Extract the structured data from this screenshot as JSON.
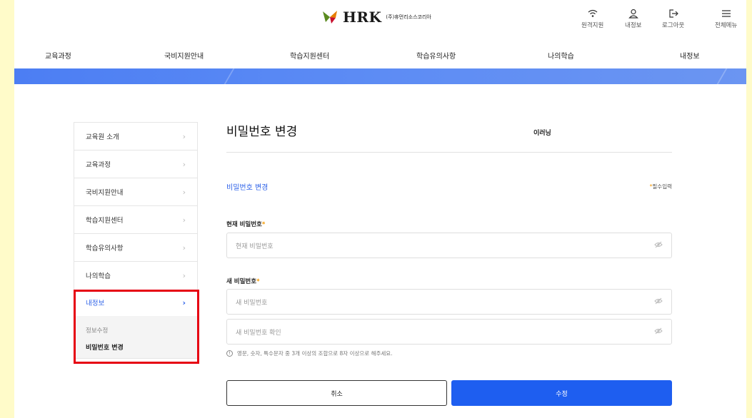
{
  "header": {
    "logo_text": "HRK",
    "logo_sub_main": "이러닝",
    "logo_sub_small": "(주)휴먼리소스코리아",
    "utils": [
      {
        "label": "원격지원",
        "icon": "wifi-icon"
      },
      {
        "label": "내정보",
        "icon": "user-icon"
      },
      {
        "label": "로그아웃",
        "icon": "logout-icon"
      },
      {
        "label": "전체메뉴",
        "icon": "menu-icon"
      }
    ]
  },
  "nav": [
    "교육과정",
    "국비지원안내",
    "학습지원센터",
    "학습유의사항",
    "나의학습",
    "내정보"
  ],
  "sidebar": {
    "items": [
      {
        "label": "교육원 소개"
      },
      {
        "label": "교육과정"
      },
      {
        "label": "국비지원안내"
      },
      {
        "label": "학습지원센터"
      },
      {
        "label": "학습유의사항"
      },
      {
        "label": "나의학습"
      }
    ],
    "active": {
      "label": "내정보"
    },
    "submenu": [
      "정보수정",
      "비밀번호 변경"
    ],
    "chevron": "›"
  },
  "main": {
    "title": "비밀번호 변경",
    "section_title": "비밀번호 변경",
    "required_note": "필수입력",
    "current_label": "현재 비밀번호",
    "current_placeholder": "현재 비밀번호",
    "new_label": "새 비밀번호",
    "new_placeholder": "새 비밀번호",
    "confirm_placeholder": "새 비밀번호 확인",
    "hint": "영문, 숫자, 특수문자 중 3개 이상의 조합으로 8자 이상으로 해주세요.",
    "hint_icon": "!",
    "cancel_label": "취소",
    "submit_label": "수정"
  },
  "colors": {
    "accent": "#2e62e8",
    "submit": "#1e5ef0",
    "required": "#f39800",
    "highlight": "#e60012"
  }
}
